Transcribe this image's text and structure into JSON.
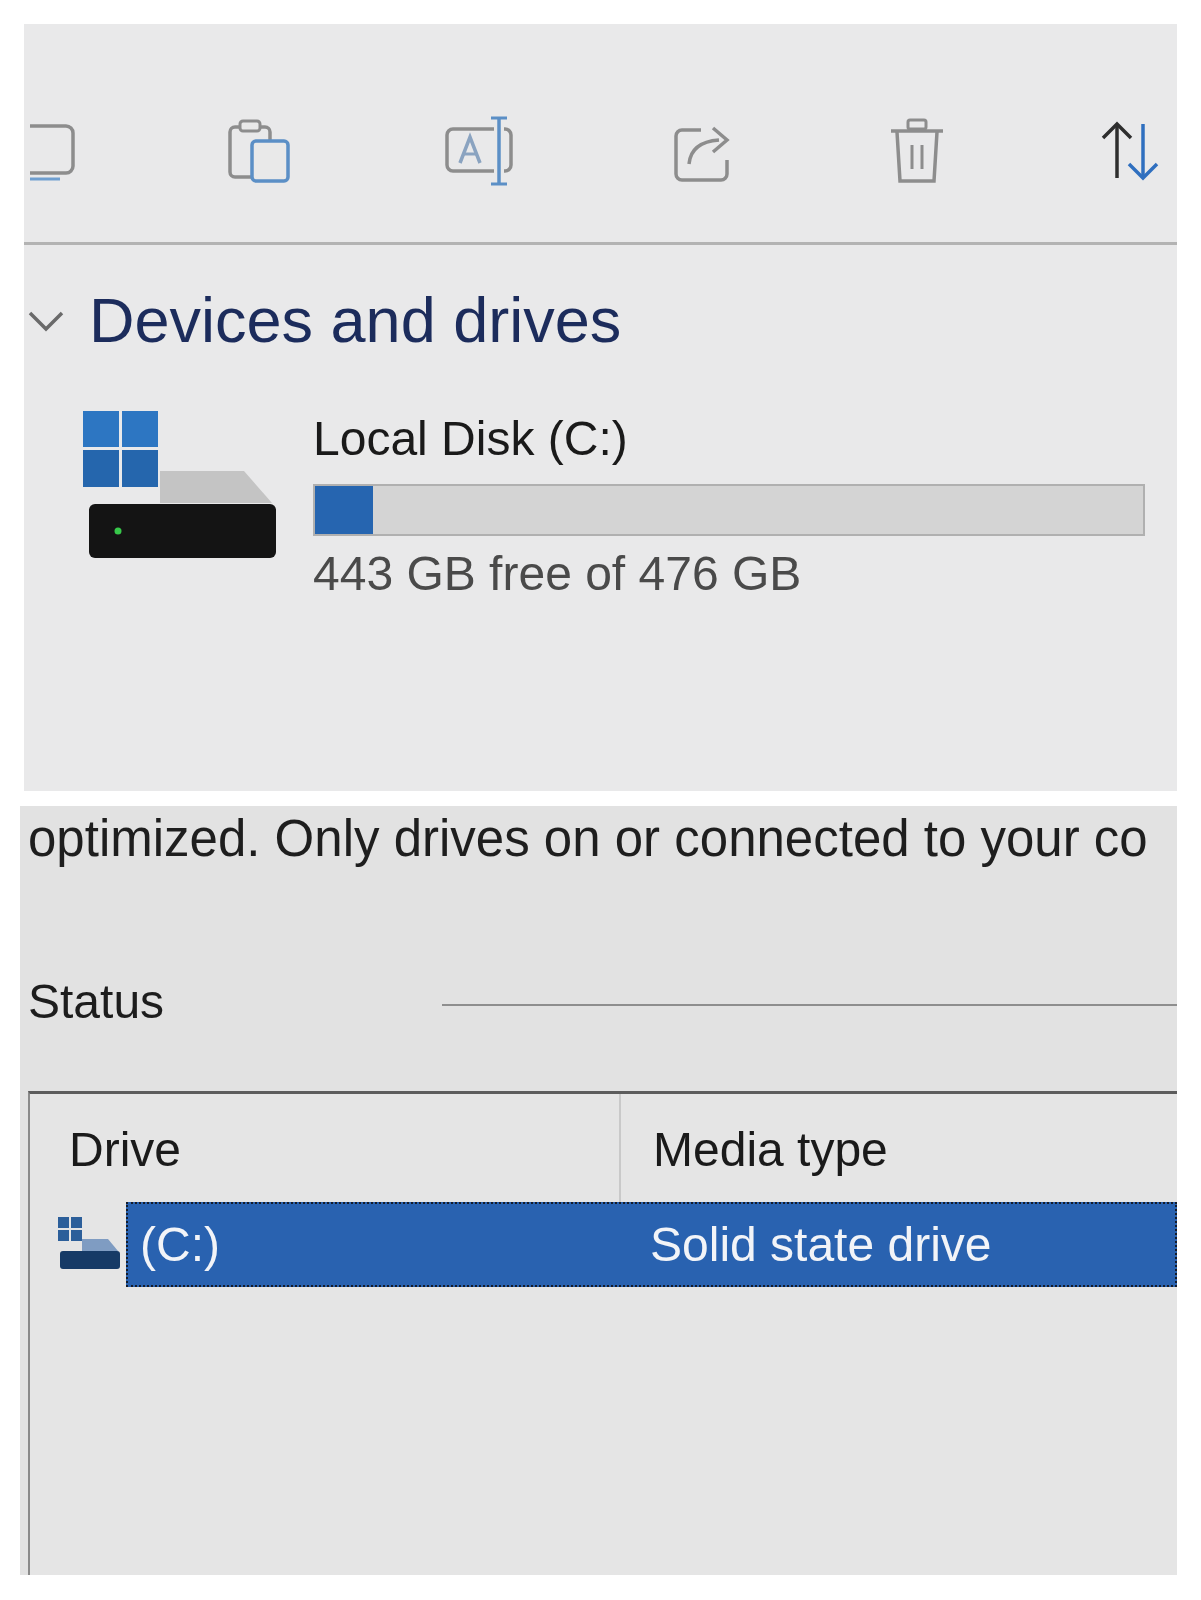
{
  "section": {
    "title": "Devices and drives",
    "expanded": true,
    "drives": [
      {
        "name": "Local Disk (C:)",
        "level": 0.07,
        "reading": "443 GB free of 476 GB"
      }
    ]
  },
  "optimize_panel": {
    "description": "optimized. Only drives on or connected to your co",
    "status_label": "Status",
    "list": {
      "columns": [
        "Drive",
        "Media type"
      ],
      "rows": [
        {
          "cells": [
            "(C:)",
            "Solid state drive"
          ],
          "selected": true
        }
      ]
    }
  }
}
